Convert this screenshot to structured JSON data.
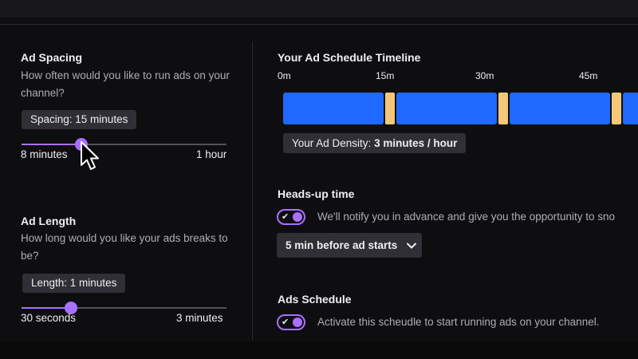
{
  "ad_spacing": {
    "title": "Ad Spacing",
    "description": "How often would you like to run ads on your channel?",
    "chip_label": "Spacing: 15  minutes",
    "slider_min_label": "8 minutes",
    "slider_max_label": "1 hour",
    "slider_value_fraction": 0.29
  },
  "ad_length": {
    "title": "Ad Length",
    "description": "How long would you like your ads breaks to be?",
    "chip_label": "Length: 1 minutes",
    "slider_min_label": "30 seconds",
    "slider_max_label": "3 minutes",
    "slider_value_fraction": 0.24
  },
  "timeline": {
    "title": "Your Ad Schedule Timeline",
    "ticks": [
      "0m",
      "15m",
      "30m",
      "45m"
    ],
    "density_label": "Your Ad Density: ",
    "density_value": "3 minutes / hour",
    "content_color": "#1f69ff",
    "ad_color": "#f5c878"
  },
  "heads_up": {
    "title": "Heads-up time",
    "toggle_on": true,
    "toggle_text": "We'll notify you in advance and give you the opportunity to sno",
    "dropdown_value": "5 min before ad starts"
  },
  "ads_schedule": {
    "title": "Ads Schedule",
    "toggle_on": true,
    "toggle_text": "Activate this scheudle to start running ads on your channel."
  },
  "colors": {
    "background": "#0e0e10",
    "accent": "#a970ff",
    "chip": "#2f2f35"
  },
  "icons": {
    "check": "✔",
    "chevron": "chevron-down-icon",
    "cursor": "mouse-pointer-icon"
  }
}
